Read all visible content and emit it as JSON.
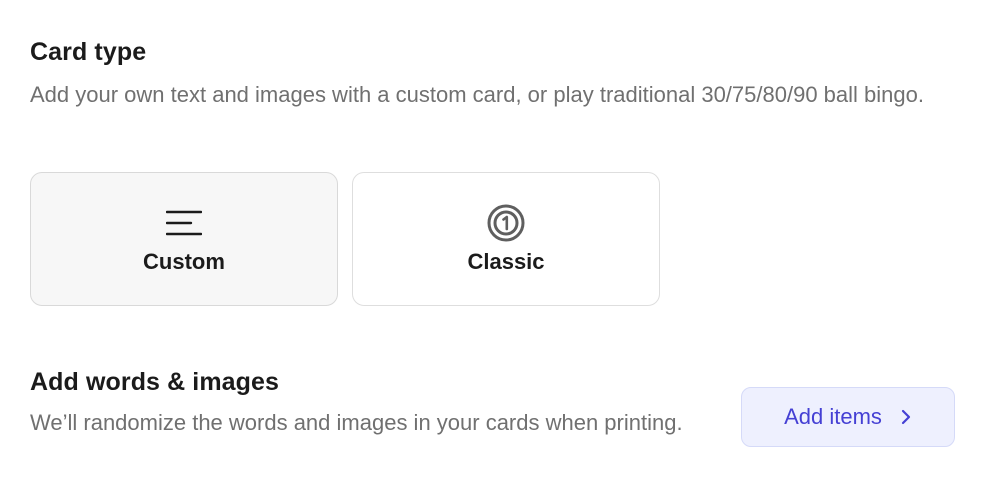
{
  "card_type": {
    "title": "Card type",
    "description": "Add your own text and images with a custom card, or play traditional 30/75/80/90 ball bingo.",
    "options": [
      {
        "label": "Custom",
        "icon": "text-lines-icon",
        "selected": true
      },
      {
        "label": "Classic",
        "icon": "number-one-circle-icon",
        "selected": false
      }
    ]
  },
  "words_images": {
    "title": "Add words & images",
    "description": "We’ll randomize the words and images in your cards when printing.",
    "button_label": "Add items",
    "button_icon": "chevron-right-icon"
  },
  "colors": {
    "accent": "#4540d4",
    "button_bg": "#eef0fe",
    "muted_text": "#707070"
  }
}
